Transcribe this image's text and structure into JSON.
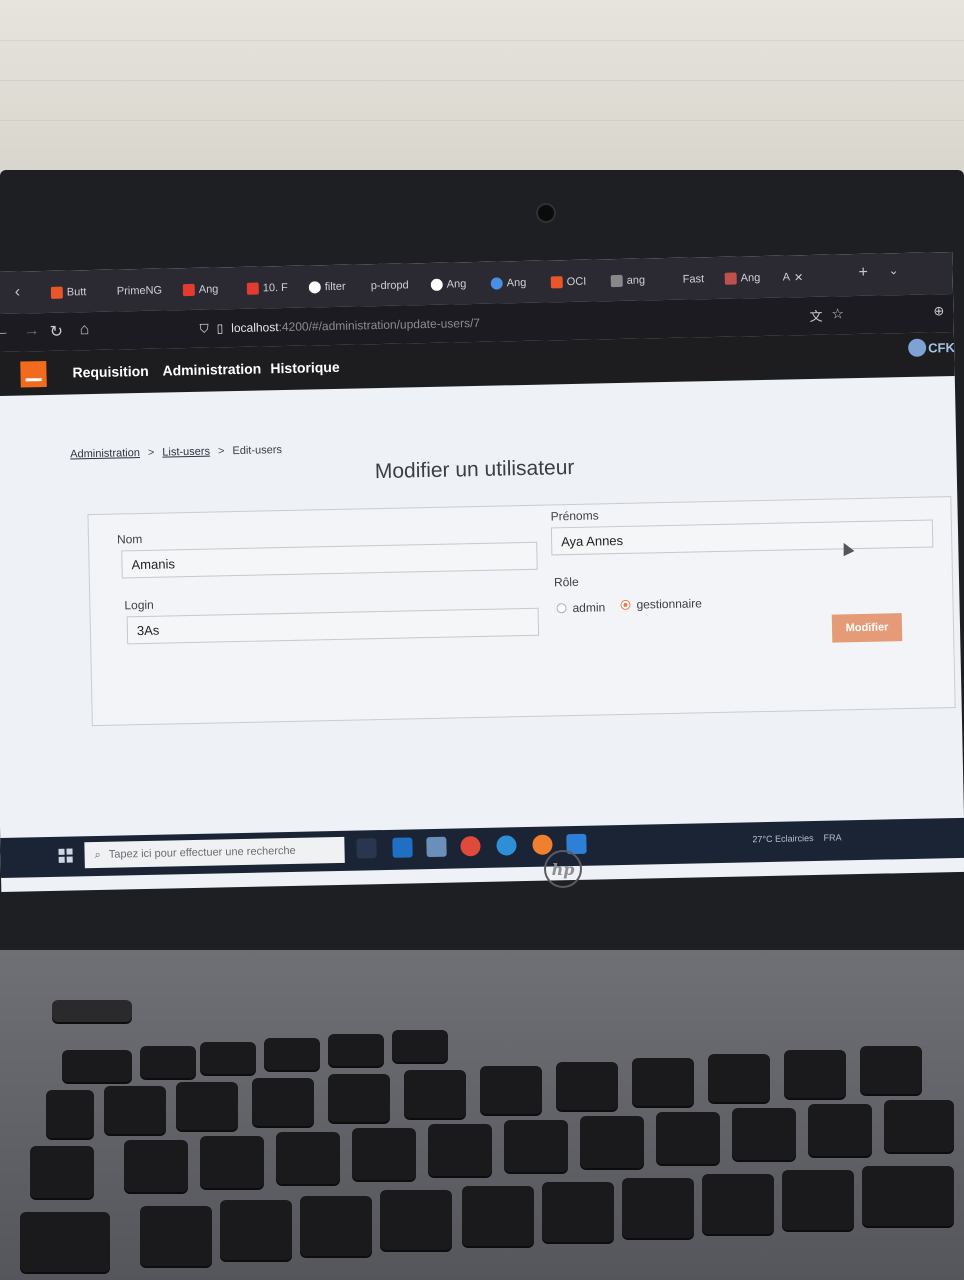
{
  "browser": {
    "tabs": [
      {
        "label": "Butt",
        "icon": "orange-square-icon",
        "color": "#e8562a"
      },
      {
        "label": "PrimeNG",
        "icon": "none",
        "color": ""
      },
      {
        "label": "Ang",
        "icon": "youtube-icon",
        "color": "#e33b2e"
      },
      {
        "label": "10. F",
        "icon": "youtube-icon",
        "color": "#e33b2e"
      },
      {
        "label": "filter",
        "icon": "google-icon",
        "color": "#ffffff"
      },
      {
        "label": "p-dropd",
        "icon": "none",
        "color": ""
      },
      {
        "label": "Ang",
        "icon": "wordpress-icon",
        "color": "#ffffff"
      },
      {
        "label": "Ang",
        "icon": "globe-icon",
        "color": "#4a90e2"
      },
      {
        "label": "OCI",
        "icon": "orange-square-icon",
        "color": "#e8562a"
      },
      {
        "label": "ang",
        "icon": "page-icon",
        "color": "#888888"
      },
      {
        "label": "Fast",
        "icon": "none",
        "color": ""
      },
      {
        "label": "Ang",
        "icon": "shield-icon",
        "color": "#c0504d"
      },
      {
        "label": "A",
        "icon": "none",
        "color": ""
      }
    ],
    "url_host": "localhost",
    "url_rest": ":4200/#/administration/update-users/7"
  },
  "app": {
    "brand_color": "#f26a1b",
    "nav": [
      "Requisition",
      "Administration",
      "Historique"
    ],
    "user_badge": "CFK"
  },
  "breadcrumb": {
    "items": [
      "Administration",
      "List-users",
      "Edit-users"
    ],
    "separator": ">"
  },
  "page": {
    "title": "Modifier un utilisateur"
  },
  "form": {
    "nom_label": "Nom",
    "nom_value": "Amanis",
    "login_label": "Login",
    "login_value": "3As",
    "prenoms_label": "Prénoms",
    "prenoms_value": "Aya Annes",
    "role_label": "Rôle",
    "roles": [
      {
        "label": "admin",
        "selected": false
      },
      {
        "label": "gestionnaire",
        "selected": true
      }
    ],
    "submit_label": "Modifier",
    "accent_color": "#e59b78"
  },
  "taskbar": {
    "search_placeholder": "Tapez ici pour effectuer une recherche",
    "weather": "27°C Eclaircies",
    "lang": "FRA"
  },
  "laptop": {
    "brand": "hp"
  }
}
